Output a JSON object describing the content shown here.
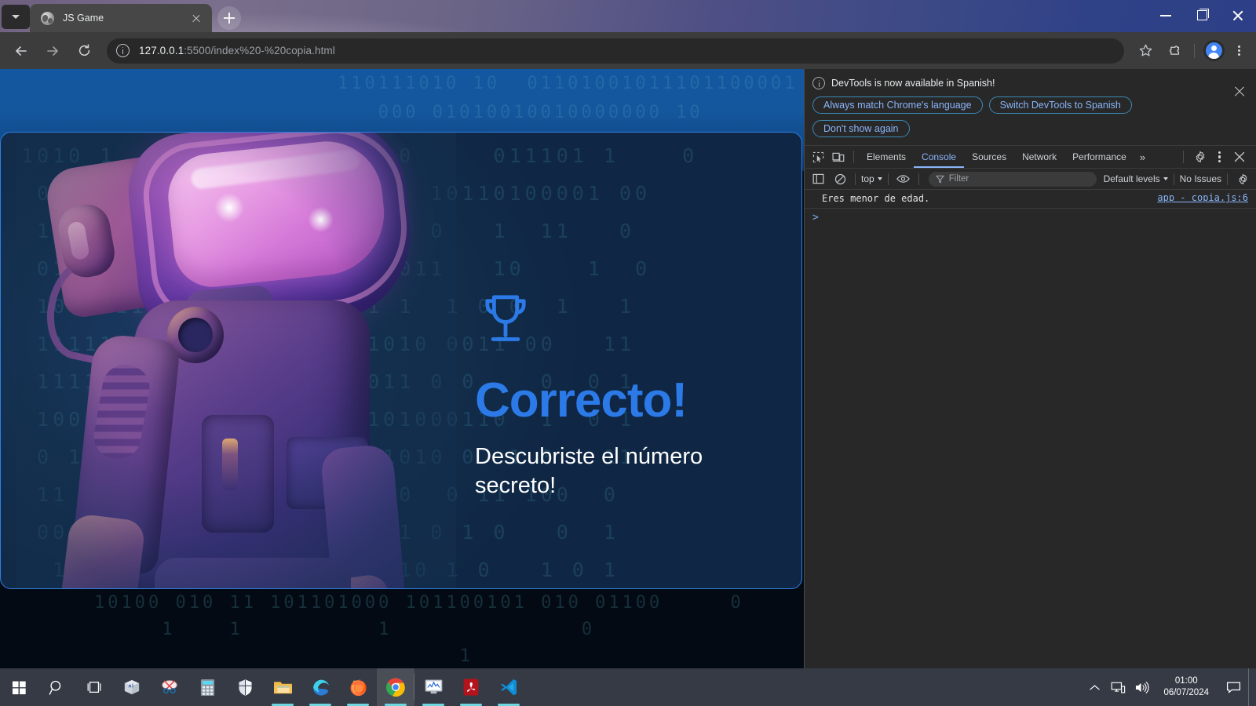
{
  "browser": {
    "tab": {
      "title": "JS Game",
      "favicon": "globe-icon",
      "close": "×"
    },
    "new_tab_tooltip": "New tab",
    "url": {
      "host": "127.0.0.1",
      "path": ":5500/index%20-%20copia.html",
      "full": "127.0.0.1:5500/index%20-%20copia.html"
    },
    "toolbar_icons": [
      "back-arrow-icon",
      "forward-arrow-icon",
      "reload-icon",
      "site-info-icon",
      "bookmark-star-icon",
      "extensions-puzzle-icon",
      "profile-avatar-icon",
      "chrome-menu-icon"
    ],
    "window_controls": [
      "minimize",
      "maximize",
      "close"
    ]
  },
  "page": {
    "title_text": "Correcto!",
    "subtitle_text": "Descubriste el número secreto!",
    "trophy_icon": "trophy-icon",
    "accent_color": "#2b7ae8",
    "card_border_color": "#2f7fe0",
    "binary_top": "110111010 10  01101001011101100001\n   000 01010010010000000 10\n         1100110 1 0    0",
    "binary_card": "1010 1     0  11010010100     011101 1    0\n 010110     101 00101111  10110100001 00\n 1    0  10100110000011 0 0   1  11   0\n 01  1 0 0 1 0 1 0 0 001011   10    1  0\n 10  011010000 1  01101 1  1 0 0  1   1\n 111111101   0111 00111010 0011 00   11\n 11110111   1000010111011 0 0    0  0 1\n 10000101 1010 11 1000101000110  1  0 1\n 0 1  0111010001011000 1010 0  1 0   11\n 11  10101 10  00001011 0  0 11 100  0\n 0001100000111101000011 1 0 1 0   0  1\n  100101100001000 1 0 0 10 1 0   1 0 1\n 0  0  110 000101 11011   0 0 1  0  0",
    "binary_bottom": "10100 010 11 101101000 101100101 010 01100     0\n     1    1          1              0\n                           1"
  },
  "devtools": {
    "banner": {
      "message": "DevTools is now available in Spanish!",
      "buttons": [
        "Always match Chrome's language",
        "Switch DevTools to Spanish",
        "Don't show again"
      ],
      "close_icon": "close-icon",
      "info_icon": "info-icon"
    },
    "tabs": [
      {
        "label": "Elements",
        "active": false
      },
      {
        "label": "Console",
        "active": true
      },
      {
        "label": "Sources",
        "active": false
      },
      {
        "label": "Network",
        "active": false
      },
      {
        "label": "Performance",
        "active": false
      }
    ],
    "more_tabs": "»",
    "tabbar_icons": [
      "inspect-element-icon",
      "device-toolbar-icon",
      "settings-gear-icon",
      "devtools-menu-icon",
      "close-devtools-icon"
    ],
    "console_toolbar": {
      "sidebar_icon": "console-sidebar-icon",
      "clear_icon": "clear-console-icon",
      "context": "top",
      "eye_icon": "live-expression-icon",
      "filter_placeholder": "Filter",
      "filter_icon": "filter-icon",
      "levels": "Default levels",
      "issues": "No Issues",
      "settings_icon": "settings-gear-icon"
    },
    "console_entries": [
      {
        "message": "Eres menor de edad.",
        "source": "app - copia.js:6"
      }
    ],
    "prompt_caret": ">"
  },
  "taskbar": {
    "items": [
      {
        "name": "start-button",
        "icon": "windows-logo-icon"
      },
      {
        "name": "search-button",
        "icon": "search-icon"
      },
      {
        "name": "task-view-button",
        "icon": "task-view-icon"
      },
      {
        "name": "store-app",
        "icon": "app-3d-icon"
      },
      {
        "name": "snipping-tool",
        "icon": "scissors-icon"
      },
      {
        "name": "calculator",
        "icon": "calculator-icon"
      },
      {
        "name": "windows-security",
        "icon": "shield-icon"
      },
      {
        "name": "file-explorer",
        "icon": "folder-icon"
      },
      {
        "name": "microsoft-edge",
        "icon": "edge-icon"
      },
      {
        "name": "mozilla-firefox",
        "icon": "firefox-icon"
      },
      {
        "name": "google-chrome",
        "icon": "chrome-icon"
      },
      {
        "name": "system-monitor",
        "icon": "monitor-chart-icon"
      },
      {
        "name": "adobe-acrobat",
        "icon": "acrobat-icon"
      },
      {
        "name": "visual-studio-code",
        "icon": "vscode-icon"
      }
    ],
    "tray": {
      "chevron": "show-hidden-icons",
      "network_icon": "network-icon",
      "volume_icon": "volume-icon",
      "time": "01:00",
      "date": "06/07/2024",
      "notification_icon": "notification-icon"
    }
  }
}
